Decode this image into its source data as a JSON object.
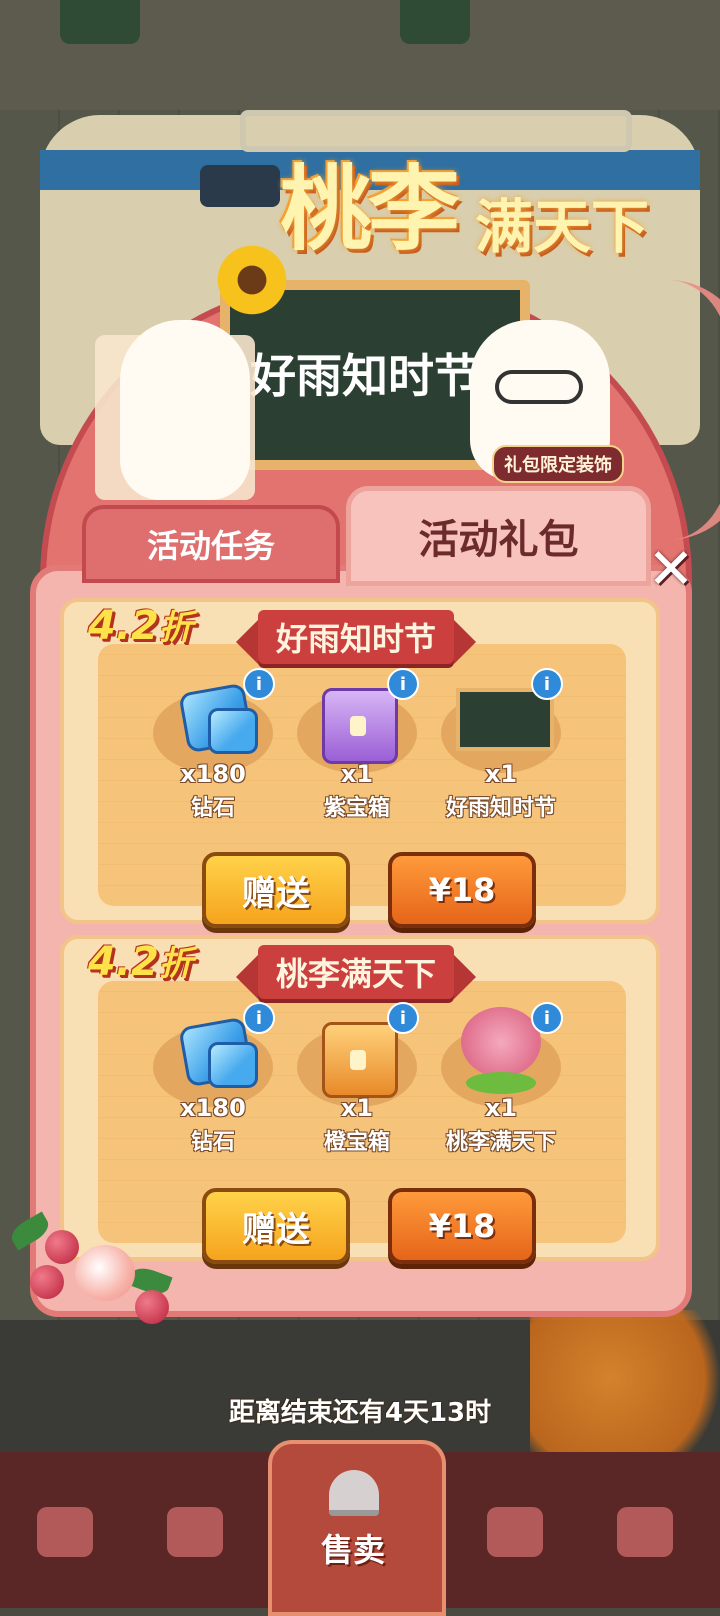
{
  "title": {
    "line1": "桃李",
    "line2": "满天下"
  },
  "banner": {
    "board_text": "好雨知时节",
    "deco_badge": "礼包限定装饰"
  },
  "tabs": {
    "task": "活动任务",
    "gift": "活动礼包"
  },
  "close_symbol": "✕",
  "packages": [
    {
      "discount": "4.2",
      "discount_unit": "折",
      "name": "好雨知时节",
      "items": [
        {
          "icon": "diamond-icon",
          "qty": "x180",
          "name": "钻石",
          "info": "i"
        },
        {
          "icon": "purple-chest-icon",
          "qty": "x1",
          "name": "紫宝箱",
          "info": "i"
        },
        {
          "icon": "chalkboard-decoration-icon",
          "qty": "x1",
          "name": "好雨知时节",
          "info": "i"
        }
      ],
      "gift_label": "赠送",
      "price_label": "¥18"
    },
    {
      "discount": "4.2",
      "discount_unit": "折",
      "name": "桃李满天下",
      "items": [
        {
          "icon": "diamond-icon",
          "qty": "x180",
          "name": "钻石",
          "info": "i"
        },
        {
          "icon": "orange-chest-icon",
          "qty": "x1",
          "name": "橙宝箱",
          "info": "i"
        },
        {
          "icon": "peach-tree-decoration-icon",
          "qty": "x1",
          "name": "桃李满天下",
          "info": "i"
        }
      ],
      "gift_label": "赠送",
      "price_label": "¥18"
    }
  ],
  "countdown": "距离结束还有4天13时",
  "nav": {
    "center_label": "售卖"
  },
  "colors": {
    "panel": "#f3b5ad",
    "title_red": "#cb3f3f",
    "gift_btn": "#f5a41c",
    "buy_btn": "#e5651a"
  }
}
